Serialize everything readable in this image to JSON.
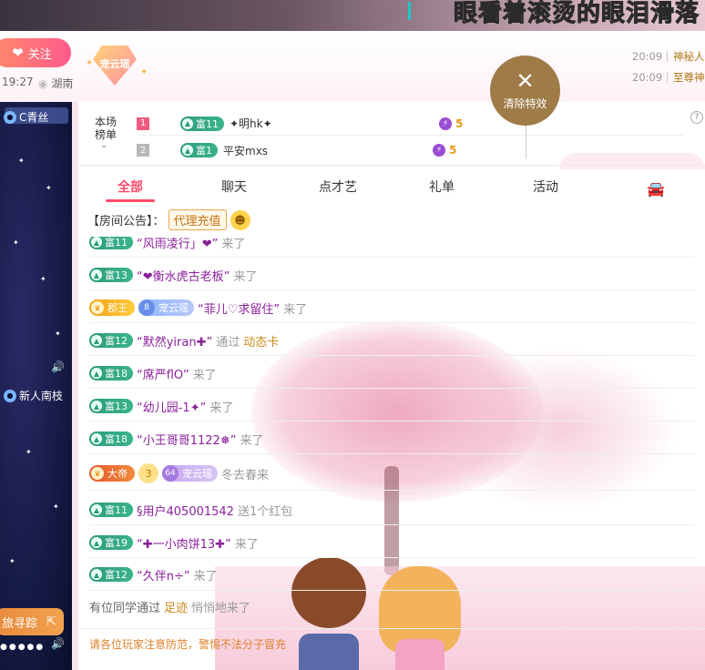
{
  "banner": {
    "lyric": "眼看着滚烫的眼泪滑落"
  },
  "header": {
    "follow_label": "关注",
    "time": "19:27",
    "location": "湖南",
    "badge_name": "宠云瑶",
    "side_messages": [
      {
        "time": "20:09",
        "name": "神秘人"
      },
      {
        "time": "20:09",
        "name": "至尊神"
      }
    ]
  },
  "clear_fx": {
    "label": "清除特效"
  },
  "sidebar": {
    "top_user": "C青丝",
    "mid_user": "新人南枝",
    "trace_label": "旅寻踪"
  },
  "rank": {
    "label_line1": "本场",
    "label_line2": "榜单",
    "rows": [
      {
        "num": "1",
        "level": "富11",
        "name": "✦明hk✦",
        "score": "5"
      },
      {
        "num": "2",
        "level": "富1",
        "name": "平安mxs",
        "score": "5"
      }
    ]
  },
  "tabs": [
    "全部",
    "聊天",
    "点才艺",
    "礼单",
    "活动"
  ],
  "notice": {
    "prefix": "【房间公告】：",
    "agent": "代理充值"
  },
  "chat": [
    {
      "level": "富11",
      "quote": "“风雨凌行」❤”",
      "rest": "来了"
    },
    {
      "level": "富13",
      "quote": "“❤衡水虎古老板”",
      "rest": "来了"
    },
    {
      "royal": "郡王",
      "fan_level": "8",
      "fan_name": "宠云瑶",
      "quote": "“菲儿♡求留住”",
      "rest": "来了"
    },
    {
      "level": "富12",
      "quote": "“默然yiran✚”",
      "rest": "通过",
      "gold": "动态卡"
    },
    {
      "level": "富18",
      "quote": "“席严flO”",
      "rest": "来了"
    },
    {
      "level": "富13",
      "quote": "“幼儿园-1✦”",
      "rest": "来了"
    },
    {
      "level": "富18",
      "quote": "“小王哥哥1122❅”",
      "rest": "来了"
    },
    {
      "royal": "大帝",
      "crown": "3",
      "fan_level": "64",
      "fan_name": "宠云瑶",
      "rest": "冬去春来"
    },
    {
      "level": "富11",
      "quote": "§用户405001542",
      "rest": "送1个红包"
    },
    {
      "level": "富19",
      "quote": "“✚一小肉饼13✚”",
      "rest": "来了"
    },
    {
      "level": "富12",
      "quote": "“久伴n÷”",
      "rest": "来了"
    }
  ],
  "system_msg": {
    "prefix": "有位同学通过",
    "gold": "足迹",
    "suffix": "悄悄地来了"
  },
  "footer": {
    "note": "请各位玩家注意防范，警惕不法分子冒充"
  },
  "colors": {
    "accent": "#ff4a6a",
    "level_green": "#2f9b7c",
    "clear_fx_brown": "#9e7b47"
  }
}
